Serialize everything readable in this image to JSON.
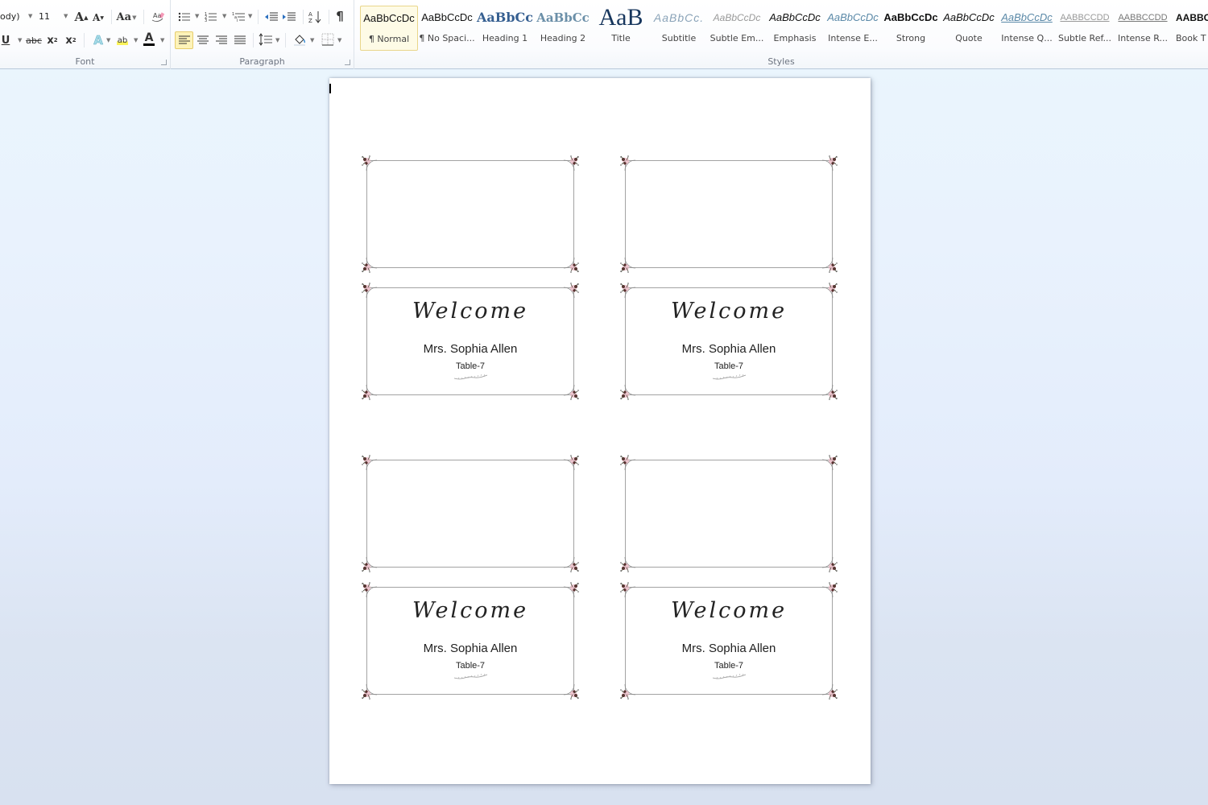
{
  "ribbon": {
    "font_group": {
      "label": "Font",
      "font_name": "ody)",
      "font_size": "11",
      "grow_font": "A",
      "shrink_font": "A",
      "change_case": "Aa",
      "clear_formatting": "A",
      "underline": "U",
      "strikethrough": "abc",
      "subscript": "x",
      "superscript": "x",
      "text_effects": "A",
      "highlight": "ab",
      "font_color": "A"
    },
    "paragraph_group": {
      "label": "Paragraph",
      "pilcrow": "¶"
    },
    "styles_group": {
      "label": "Styles",
      "items": [
        {
          "sample": "AaBbCcDc",
          "name": "¶ Normal",
          "selected": true
        },
        {
          "sample": "AaBbCcDc",
          "name": "¶ No Spaci..."
        },
        {
          "sample": "AaBbCc",
          "name": "Heading 1"
        },
        {
          "sample": "AaBbCc",
          "name": "Heading 2"
        },
        {
          "sample": "AaB",
          "name": "Title"
        },
        {
          "sample": "AaBbCc.",
          "name": "Subtitle"
        },
        {
          "sample": "AaBbCcDc",
          "name": "Subtle Em..."
        },
        {
          "sample": "AaBbCcDc",
          "name": "Emphasis"
        },
        {
          "sample": "AaBbCcDc",
          "name": "Intense E..."
        },
        {
          "sample": "AaBbCcDc",
          "name": "Strong"
        },
        {
          "sample": "AaBbCcDc",
          "name": "Quote"
        },
        {
          "sample": "AaBbCcDc",
          "name": "Intense Q..."
        },
        {
          "sample": "AABBCCDD",
          "name": "Subtle Ref..."
        },
        {
          "sample": "AABBCCDD",
          "name": "Intense R..."
        },
        {
          "sample": "AABBC",
          "name": "Book T"
        }
      ]
    }
  },
  "document": {
    "cards": [
      {
        "position": "top-left-back",
        "welcome": "",
        "name": "",
        "table": ""
      },
      {
        "position": "top-right-back",
        "welcome": "",
        "name": "",
        "table": ""
      },
      {
        "position": "top-left-front",
        "welcome": "Welcome",
        "name": "Mrs. Sophia Allen",
        "table": "Table-7"
      },
      {
        "position": "top-right-front",
        "welcome": "Welcome",
        "name": "Mrs. Sophia Allen",
        "table": "Table-7"
      },
      {
        "position": "bottom-left-back",
        "welcome": "",
        "name": "",
        "table": ""
      },
      {
        "position": "bottom-right-back",
        "welcome": "",
        "name": "",
        "table": ""
      },
      {
        "position": "bottom-left-front",
        "welcome": "Welcome",
        "name": "Mrs. Sophia Allen",
        "table": "Table-7"
      },
      {
        "position": "bottom-right-front",
        "welcome": "Welcome",
        "name": "Mrs. Sophia Allen",
        "table": "Table-7"
      }
    ]
  },
  "colors": {
    "card_border": "#a3a3a3",
    "flower_pink": "#e8b4c0",
    "flower_dark": "#5a2e2e",
    "selected_style_bg": "#fefbe6",
    "active_button_bg": "#fdf3b9"
  }
}
